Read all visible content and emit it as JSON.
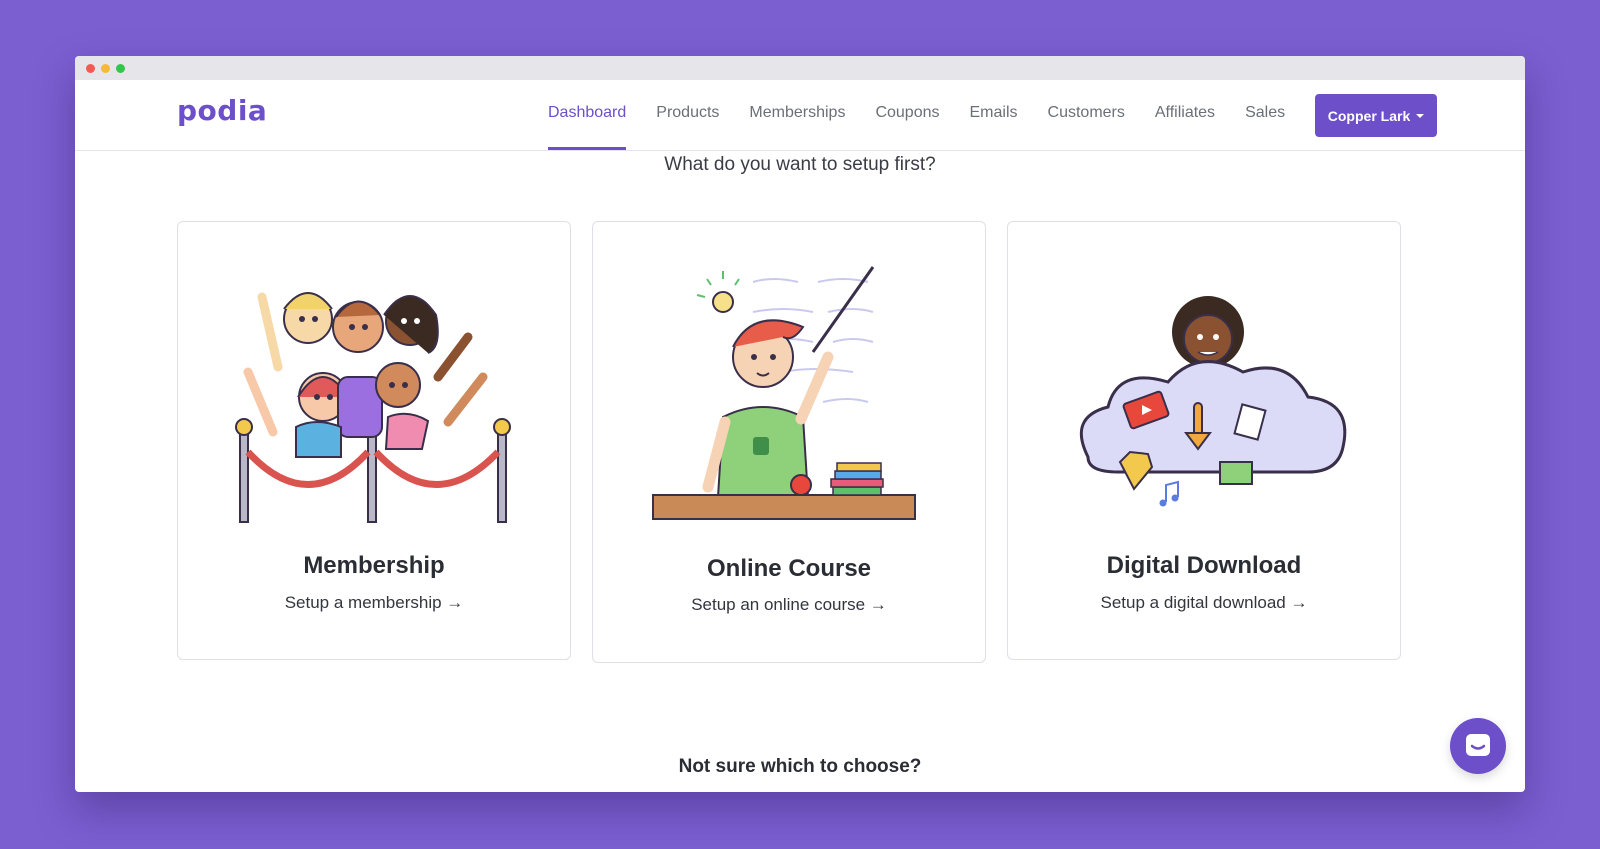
{
  "brand": {
    "name": "podia",
    "accent": "#6c4fc9",
    "background": "#7b5ed0"
  },
  "nav": {
    "items": [
      {
        "label": "Dashboard",
        "active": true
      },
      {
        "label": "Products",
        "active": false
      },
      {
        "label": "Memberships",
        "active": false
      },
      {
        "label": "Coupons",
        "active": false
      },
      {
        "label": "Emails",
        "active": false
      },
      {
        "label": "Customers",
        "active": false
      },
      {
        "label": "Affiliates",
        "active": false
      },
      {
        "label": "Sales",
        "active": false
      }
    ],
    "account_label": "Copper Lark"
  },
  "main": {
    "prompt": "What do you want to setup first?",
    "cards": [
      {
        "title": "Membership",
        "link": "Setup a membership →",
        "illustration": "membership-crowd-illustration"
      },
      {
        "title": "Online Course",
        "link": "Setup an online course →",
        "illustration": "teacher-illustration"
      },
      {
        "title": "Digital Download",
        "link": "Setup a digital download →",
        "illustration": "cloud-download-illustration"
      }
    ],
    "bottom_question": "Not sure which to choose?"
  },
  "chat": {
    "icon": "chat-bubble-icon"
  }
}
